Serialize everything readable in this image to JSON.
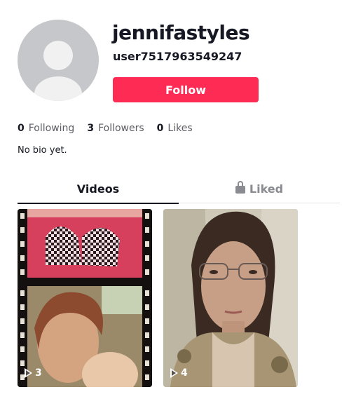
{
  "profile": {
    "username": "jennifastyles",
    "nickname": "user7517963549247",
    "follow_label": "Follow",
    "bio": "No bio yet."
  },
  "stats": {
    "following": {
      "count": "0",
      "label": "Following"
    },
    "followers": {
      "count": "3",
      "label": "Followers"
    },
    "likes": {
      "count": "0",
      "label": "Likes"
    }
  },
  "tabs": {
    "videos": "Videos",
    "liked": "Liked"
  },
  "videos": [
    {
      "views": "3"
    },
    {
      "views": "4"
    }
  ],
  "colors": {
    "accent": "#fe2c55",
    "text": "#161823",
    "muted": "#8a8b91"
  },
  "icons": [
    "default-avatar-icon",
    "lock-icon",
    "play-icon"
  ]
}
